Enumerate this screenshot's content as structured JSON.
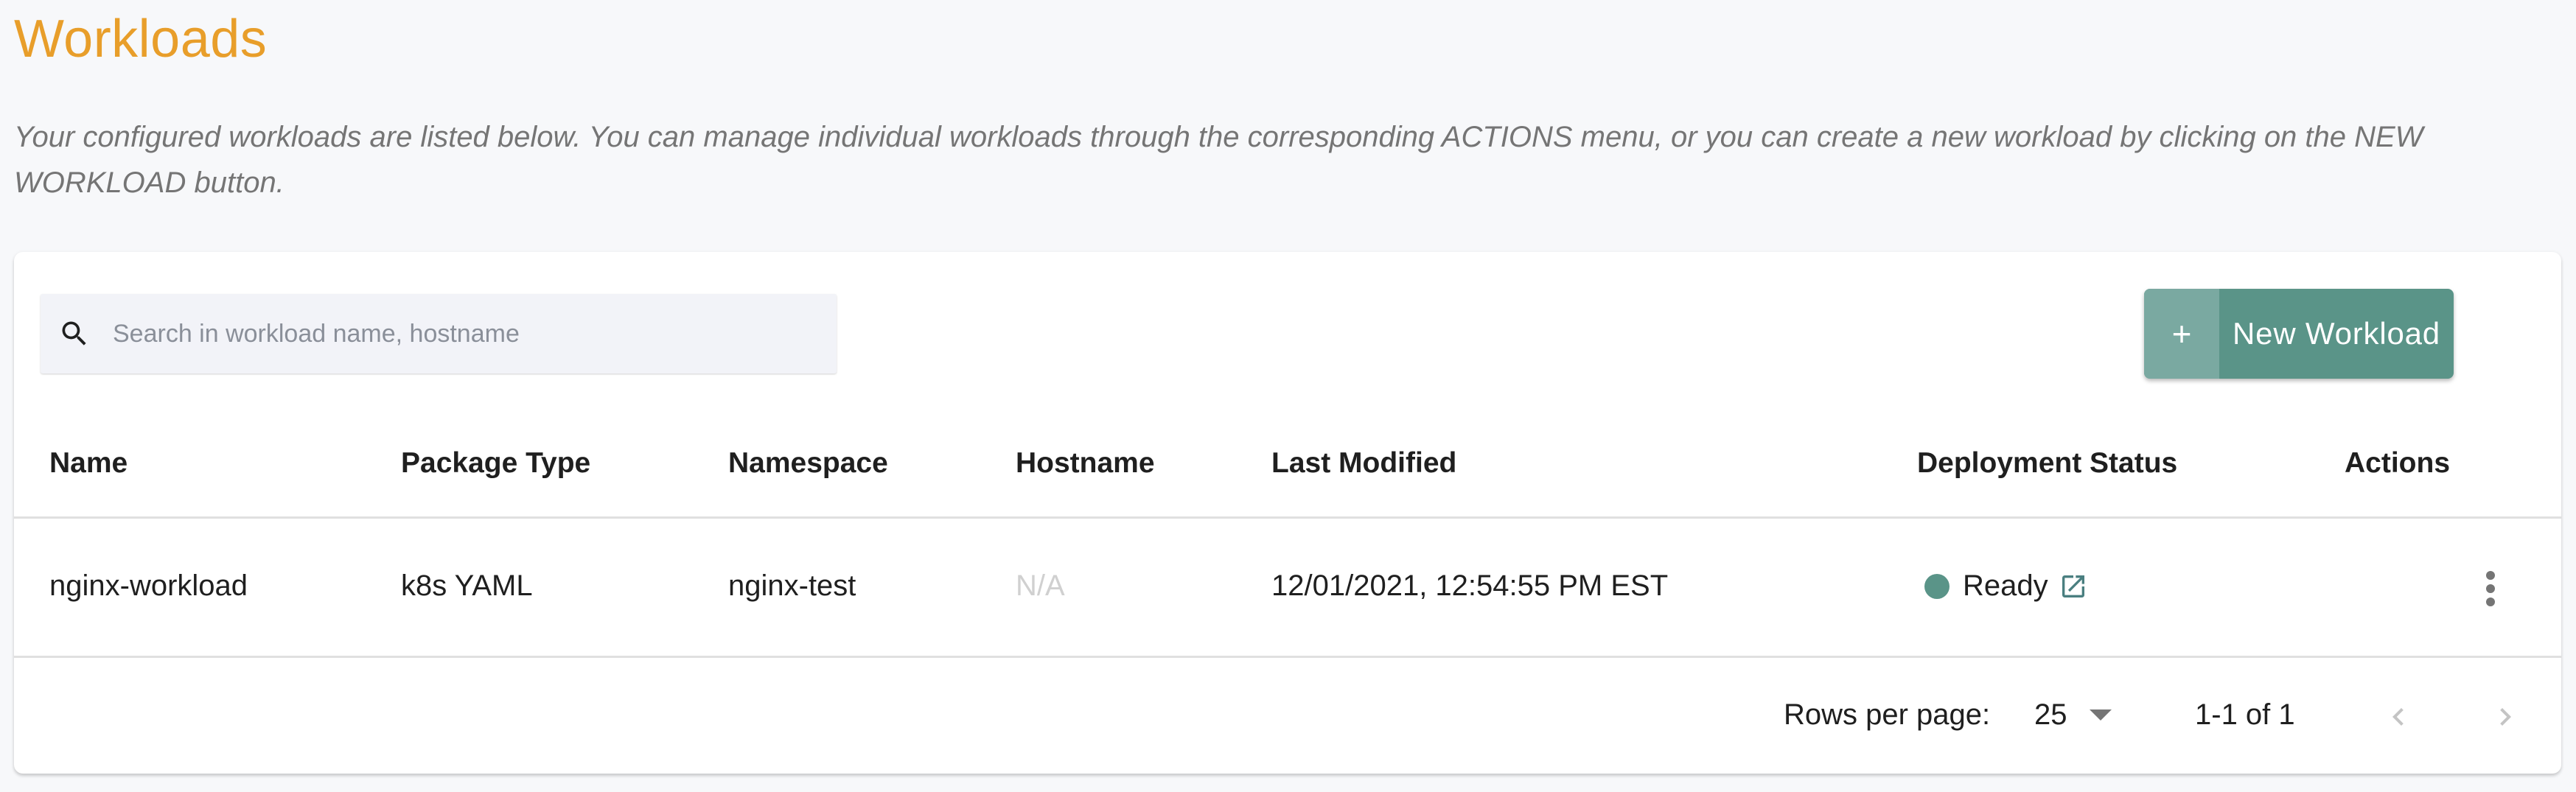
{
  "page": {
    "title": "Workloads",
    "description": "Your configured workloads are listed below. You can manage individual workloads through the corresponding ACTIONS menu, or you can create a new workload by clicking on the NEW WORKLOAD button."
  },
  "toolbar": {
    "search_placeholder": "Search in workload name, hostname",
    "search_value": "",
    "search_icon": "search-icon",
    "new_button_icon": "+",
    "new_button_label": "New Workload"
  },
  "table": {
    "columns": [
      "Name",
      "Package Type",
      "Namespace",
      "Hostname",
      "Last Modified",
      "Deployment Status",
      "Actions"
    ],
    "rows": [
      {
        "name": "nginx-workload",
        "package_type": "k8s YAML",
        "namespace": "nginx-test",
        "hostname": "N/A",
        "last_modified": "12/01/2021, 12:54:55 PM EST",
        "status": "Ready",
        "status_icon": "external-link-icon",
        "actions_icon": "more-vert-icon"
      }
    ]
  },
  "pagination": {
    "rows_per_page_label": "Rows per page:",
    "rows_per_page_value": "25",
    "range_label": "1-1 of 1",
    "prev_icon": "chevron-left-icon",
    "next_icon": "chevron-right-icon"
  },
  "colors": {
    "title": "#e89e2a",
    "accent": "#5a9488",
    "link": "#4a7f80",
    "status_ready": "#5a9488",
    "muted": "#d0d0d0"
  }
}
